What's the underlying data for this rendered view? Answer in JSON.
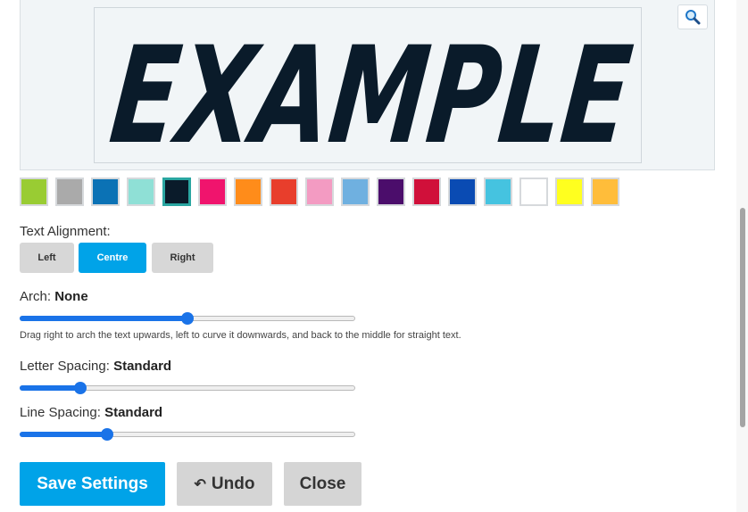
{
  "preview": {
    "text": "EXAMPLE",
    "text_color": "#0a1b2a",
    "zoom_icon": "magnifier-icon"
  },
  "swatches": [
    {
      "color": "#99cc33",
      "selected": false
    },
    {
      "color": "#aaaaaa",
      "selected": false
    },
    {
      "color": "#0b72b5",
      "selected": false
    },
    {
      "color": "#8fe0d6",
      "selected": false
    },
    {
      "color": "#0a1b2a",
      "selected": true
    },
    {
      "color": "#f0146d",
      "selected": false
    },
    {
      "color": "#ff8c1a",
      "selected": false
    },
    {
      "color": "#e83e2c",
      "selected": false
    },
    {
      "color": "#f39bc2",
      "selected": false
    },
    {
      "color": "#6fb0e0",
      "selected": false
    },
    {
      "color": "#4b0d6b",
      "selected": false
    },
    {
      "color": "#d0103a",
      "selected": false
    },
    {
      "color": "#0a4bb3",
      "selected": false
    },
    {
      "color": "#45c3e0",
      "selected": false
    },
    {
      "color": "#ffffff",
      "selected": false
    },
    {
      "color": "#ffff1f",
      "selected": false
    },
    {
      "color": "#ffbd3a",
      "selected": false
    }
  ],
  "alignment": {
    "label": "Text Alignment:",
    "options": [
      "Left",
      "Centre",
      "Right"
    ],
    "selected": "Centre"
  },
  "arch": {
    "label": "Arch:",
    "value_label": "None",
    "slider_value": 0.5,
    "hint": "Drag right to arch the text upwards, left to curve it downwards, and back to the middle for straight text."
  },
  "letter_spacing": {
    "label": "Letter Spacing:",
    "value_label": "Standard",
    "slider_value": 0.18
  },
  "line_spacing": {
    "label": "Line Spacing:",
    "value_label": "Standard",
    "slider_value": 0.26
  },
  "actions": {
    "save": "Save Settings",
    "undo": "Undo",
    "undo_icon": "undo-arrow-icon",
    "close": "Close"
  },
  "accent_color": "#00a3e8",
  "slider_color": "#1a73e8"
}
